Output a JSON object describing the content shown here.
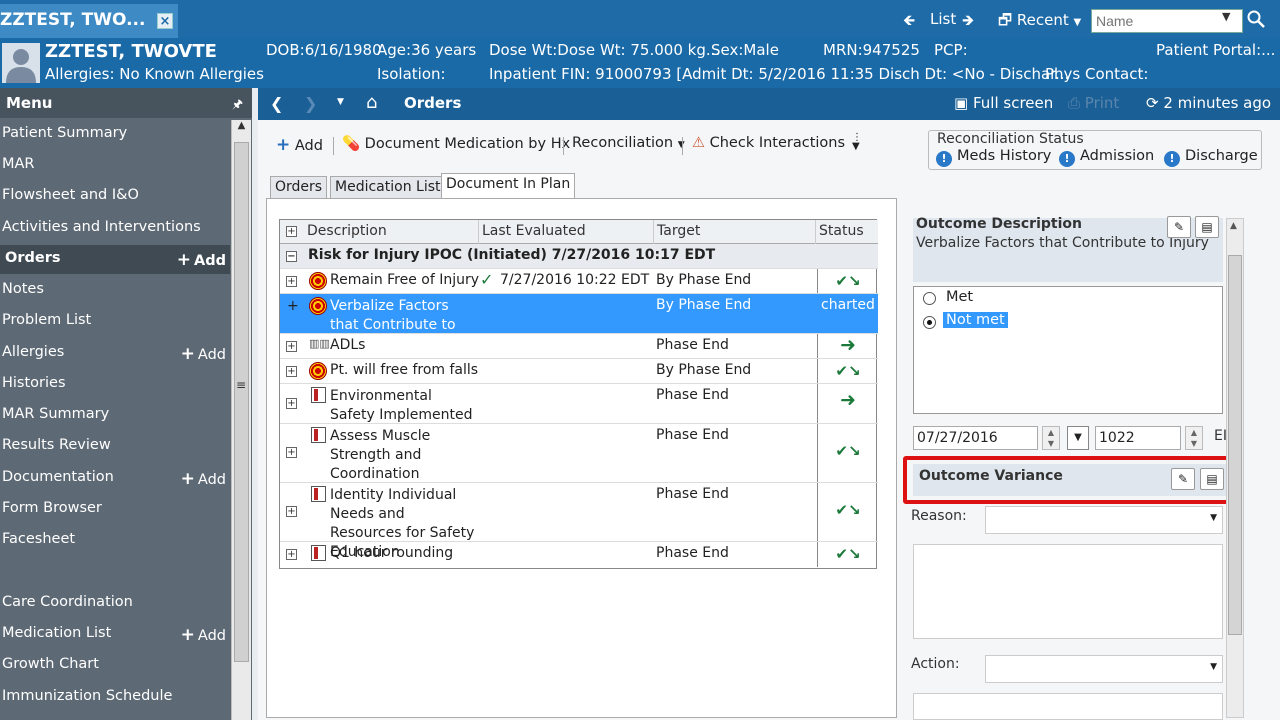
{
  "titlebar": {
    "patient_tab": "ZZTEST, TWO...",
    "close_glyph": "×",
    "list_label": "List",
    "recent_label": "Recent",
    "name_placeholder": "Name",
    "back_icon": "arrow-left-icon",
    "forward_icon": "arrow-right-icon"
  },
  "banner": {
    "patient_name": "ZZTEST, TWOVTE",
    "allergies": "Allergies: No Known Allergies",
    "dob": "DOB:6/16/1980",
    "age": "Age:36 years",
    "dose_wt": "Dose Wt:Dose Wt: 75.000 kg...",
    "sex": "Sex:Male",
    "mrn": "MRN:947525",
    "pcp": "PCP:",
    "portal": "Patient Portal:...",
    "isolation": "Isolation:",
    "fin": "Inpatient FIN: 91000793 [Admit Dt: 5/2/2016 11:35 Disch Dt: <No - Dischar...",
    "phys_contact": "Phys Contact:"
  },
  "menu": {
    "title": "Menu",
    "add_label": "Add",
    "items": [
      {
        "label": "Patient Summary"
      },
      {
        "label": "MAR"
      },
      {
        "label": "Flowsheet and I&O"
      },
      {
        "label": "Activities and Interventions"
      },
      {
        "label": "Orders"
      },
      {
        "label": "Notes"
      },
      {
        "label": "Problem List"
      },
      {
        "label": "Allergies"
      },
      {
        "label": "Histories"
      },
      {
        "label": "MAR Summary"
      },
      {
        "label": "Results Review"
      },
      {
        "label": "Documentation"
      },
      {
        "label": "Form Browser"
      },
      {
        "label": "Facesheet"
      },
      {
        "label": ""
      },
      {
        "label": "Care Coordination"
      },
      {
        "label": "Medication List"
      },
      {
        "label": "Growth Chart"
      },
      {
        "label": "Immunization Schedule"
      }
    ]
  },
  "navbar": {
    "title": "Orders",
    "full_screen": "Full screen",
    "print": "Print",
    "refresh": "2 minutes ago"
  },
  "toolbar": {
    "add": "Add",
    "doc_med": "Document Medication by Hx",
    "reconciliation": "Reconciliation",
    "check_interactions": "Check Interactions",
    "recon_title": "Reconciliation Status",
    "meds_history": "Meds History",
    "admission": "Admission",
    "discharge": "Discharge"
  },
  "subtabs": [
    "Orders",
    "Medication List",
    "Document In Plan"
  ],
  "grid": {
    "headers": {
      "description": "Description",
      "last_evaluated": "Last Evaluated",
      "target": "Target",
      "status": "Status"
    },
    "group": "Risk for Injury IPOC (Initiated) 7/27/2016 10:17 EDT",
    "rows": [
      {
        "desc": "Remain Free of Injury",
        "last": "7/27/2016 10:22 EDT",
        "target": "By Phase End",
        "status": ""
      },
      {
        "desc": "Verbalize Factors that Contribute to Injury",
        "last": "",
        "target": "By Phase End",
        "status": "charted"
      },
      {
        "desc": "ADLs",
        "last": "",
        "target": "Phase End",
        "status": ""
      },
      {
        "desc": "Pt. will free from falls",
        "last": "",
        "target": "By Phase End",
        "status": ""
      },
      {
        "desc": "Environmental Safety Implemented",
        "last": "",
        "target": "Phase End",
        "status": ""
      },
      {
        "desc": "Assess Muscle Strength and Coordination",
        "last": "",
        "target": "Phase End",
        "status": ""
      },
      {
        "desc": "Identity Individual Needs and Resources for Safety Education",
        "last": "",
        "target": "Phase End",
        "status": ""
      },
      {
        "desc": "Q1 hour rounding",
        "last": "",
        "target": "Phase End",
        "status": ""
      }
    ]
  },
  "outcome": {
    "desc_title": "Outcome Description",
    "desc_text": "Verbalize Factors that Contribute to Injury",
    "met": "Met",
    "not_met": "Not met",
    "date": "07/27/2016",
    "time": "1022",
    "tz": "EI",
    "variance_title": "Outcome Variance",
    "reason_label": "Reason:",
    "action_label": "Action:"
  }
}
